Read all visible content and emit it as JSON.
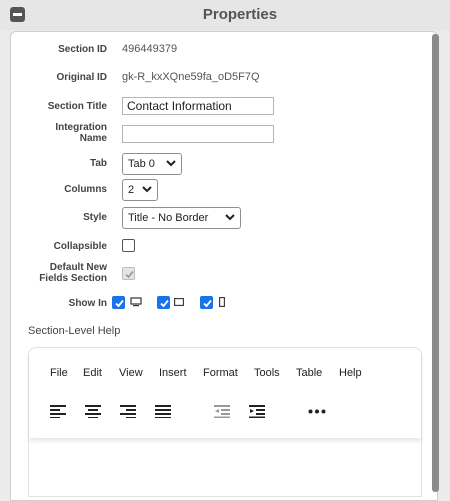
{
  "header": {
    "title": "Properties"
  },
  "fields": {
    "section_id": {
      "label": "Section ID",
      "value": "496449379"
    },
    "original_id": {
      "label": "Original ID",
      "value": "gk-R_kxXQne59fa_oD5F7Q"
    },
    "section_title": {
      "label": "Section Title",
      "value": "Contact Information"
    },
    "integration_name": {
      "label": "Integration Name",
      "value": ""
    },
    "tab": {
      "label": "Tab",
      "selected": "Tab 0"
    },
    "columns": {
      "label": "Columns",
      "selected": "2"
    },
    "style": {
      "label": "Style",
      "selected": "Title - No Border"
    },
    "collapsible": {
      "label": "Collapsible",
      "checked": false
    },
    "default_new_fields": {
      "label": "Default New Fields Section",
      "checked": true,
      "disabled": true
    },
    "show_in": {
      "label": "Show In",
      "options": [
        {
          "icon": "desktop-icon",
          "checked": true
        },
        {
          "icon": "tablet-icon",
          "checked": true
        },
        {
          "icon": "phone-icon",
          "checked": true
        }
      ]
    }
  },
  "help": {
    "label": "Section-Level Help",
    "menu": [
      "File",
      "Edit",
      "View",
      "Insert",
      "Format",
      "Tools",
      "Table",
      "Help"
    ],
    "toolbar_icons": [
      "align-left-icon",
      "align-center-icon",
      "align-right-icon",
      "justify-icon",
      "outdent-icon",
      "indent-icon",
      "more-icon"
    ]
  },
  "colors": {
    "accent": "#1a73e8",
    "header_bg": "#e6e6e6",
    "page_bg": "#ebebeb"
  }
}
